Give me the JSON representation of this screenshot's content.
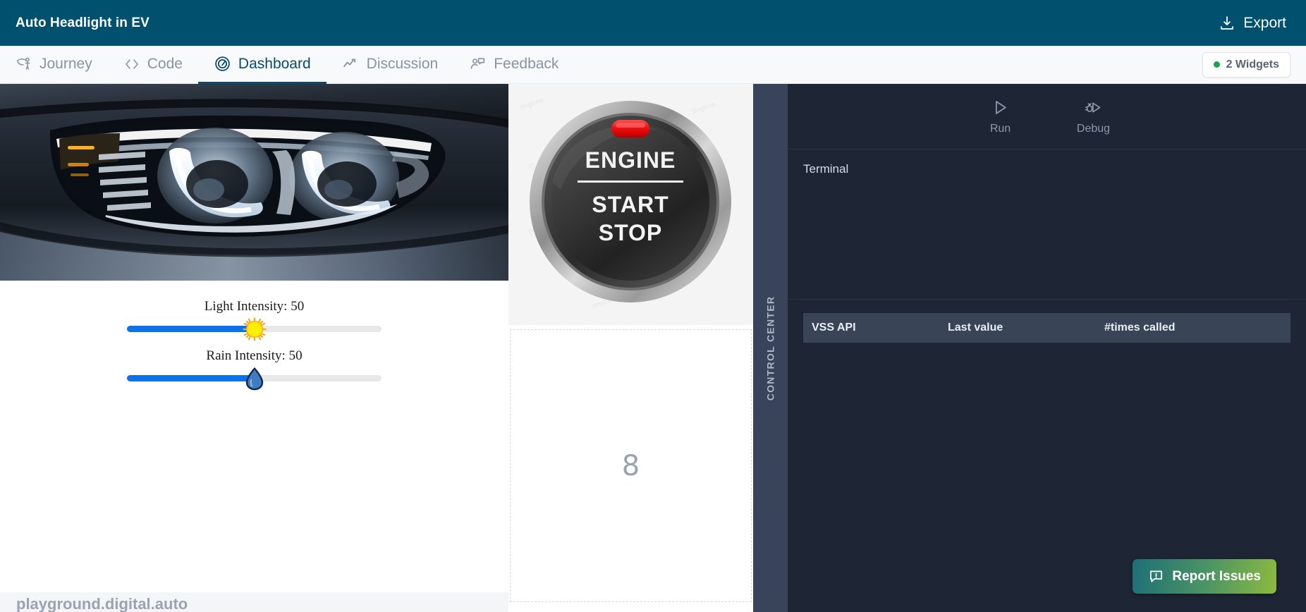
{
  "topbar": {
    "title": "Auto Headlight in EV",
    "export_label": "Export",
    "export_icon": "download-icon",
    "bg_color": "#00506e"
  },
  "tabs": {
    "items": [
      {
        "label": "Journey",
        "icon": "journey-icon",
        "active": false
      },
      {
        "label": "Code",
        "icon": "code-icon",
        "active": false
      },
      {
        "label": "Dashboard",
        "icon": "gauge-icon",
        "active": true
      },
      {
        "label": "Discussion",
        "icon": "activity-icon",
        "active": false
      },
      {
        "label": "Feedback",
        "icon": "user-chat-icon",
        "active": false
      }
    ],
    "widgets_badge": {
      "label": "2 Widgets",
      "status_icon": "green-dot-icon",
      "status_color": "#19a44b"
    },
    "active_color": "#0b4a68",
    "inactive_color": "#8a93a5"
  },
  "left_pane": {
    "image_name": "car-headlight-photo",
    "sliders": [
      {
        "label": "Light Intensity: 50",
        "name": "light-intensity-slider",
        "value": 50,
        "min": 0,
        "max": 100,
        "thumb_icon": "sun-icon",
        "fill_color": "#0b72e8",
        "thumb_color": "#ffee00"
      },
      {
        "label": "Rain Intensity: 50",
        "name": "rain-intensity-slider",
        "value": 50,
        "min": 0,
        "max": 100,
        "thumb_icon": "water-drop-icon",
        "fill_color": "#0b72e8",
        "thumb_color": "#3f7cc0"
      }
    ],
    "footer_url": "playground.digital.auto"
  },
  "widget_column": {
    "engine_button": {
      "name": "engine-start-stop-button",
      "line1": "ENGINE",
      "line2": "START",
      "line3": "STOP",
      "indicator_color": "#e81414",
      "watermark": "pngtree"
    },
    "empty_slot": {
      "name": "empty-widget-slot",
      "number": "8"
    }
  },
  "control_center": {
    "label": "CONTROL CENTER",
    "bg_color": "#39435a"
  },
  "right_panel": {
    "bg_color": "#1e2635",
    "actions": [
      {
        "label": "Run",
        "icon": "play-icon",
        "name": "run-button"
      },
      {
        "label": "Debug",
        "icon": "debug-icon",
        "name": "debug-button"
      }
    ],
    "terminal": {
      "title": "Terminal",
      "content": ""
    },
    "api_table": {
      "columns": [
        "VSS API",
        "Last value",
        "#times called"
      ],
      "rows": []
    },
    "report_button": {
      "label": "Report Issues",
      "icon": "comment-alert-icon",
      "gradient_from": "#1d6f77",
      "gradient_to": "#8cba3f"
    }
  }
}
